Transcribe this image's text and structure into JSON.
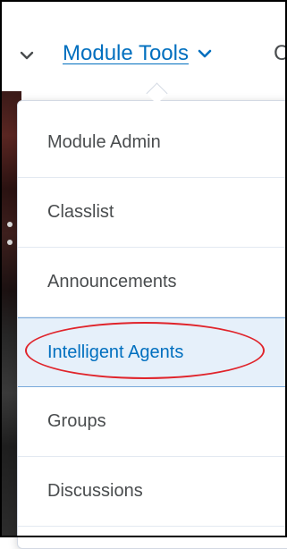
{
  "navbar": {
    "prev_chevron_icon": "chevron-down-icon",
    "module_tools_label": "Module Tools",
    "module_tools_icon": "chevron-down-icon",
    "next_item_fragment": "C"
  },
  "menu": {
    "items": [
      {
        "label": "Module Admin"
      },
      {
        "label": "Classlist"
      },
      {
        "label": "Announcements"
      },
      {
        "label": "Intelligent Agents",
        "selected": true,
        "annotated": true
      },
      {
        "label": "Groups"
      },
      {
        "label": "Discussions"
      }
    ]
  },
  "colors": {
    "link": "#006fbf",
    "text": "#494c4e",
    "selected_bg": "#e6f0fa",
    "annotation": "#e0242b"
  }
}
